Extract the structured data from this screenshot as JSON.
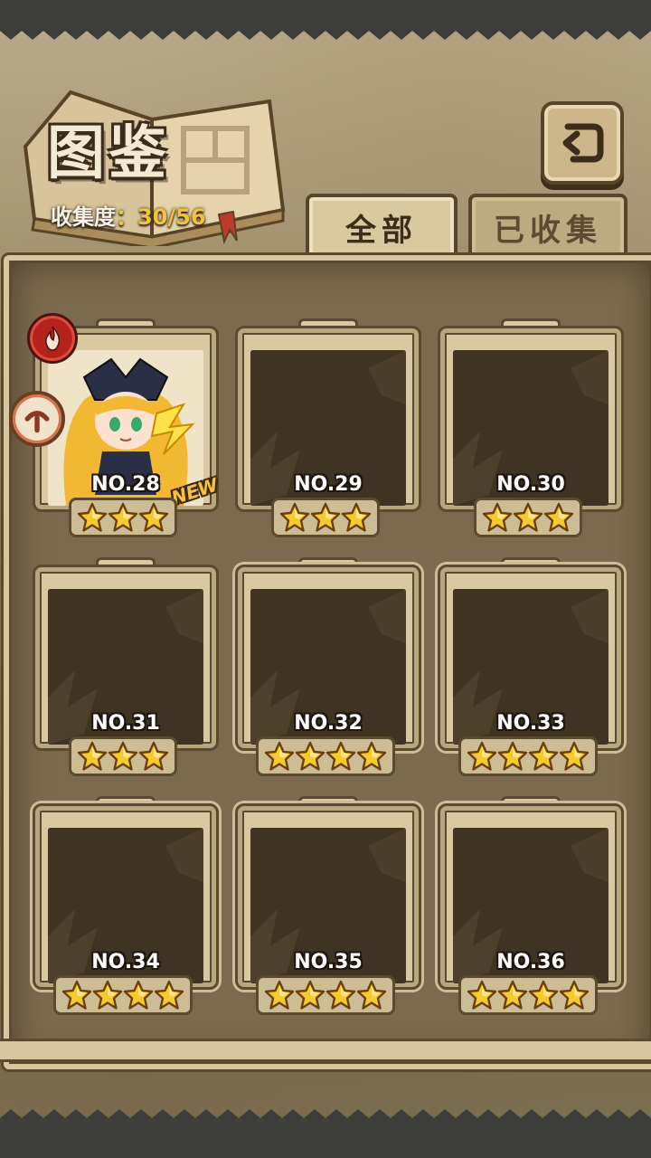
{
  "header": {
    "title": "图鉴",
    "progress_label": "收集度",
    "progress_colon": "：",
    "progress_value": "30/56"
  },
  "tabs": [
    {
      "label": "全部",
      "active": true
    },
    {
      "label": "已收集",
      "active": false
    }
  ],
  "cards": [
    {
      "number": "NO.28",
      "stars": 3,
      "owned": true,
      "new_badge": "NEW"
    },
    {
      "number": "NO.29",
      "stars": 3,
      "owned": false
    },
    {
      "number": "NO.30",
      "stars": 3,
      "owned": false
    },
    {
      "number": "NO.31",
      "stars": 3,
      "owned": false
    },
    {
      "number": "NO.32",
      "stars": 4,
      "owned": false
    },
    {
      "number": "NO.33",
      "stars": 4,
      "owned": false
    },
    {
      "number": "NO.34",
      "stars": 4,
      "owned": false
    },
    {
      "number": "NO.35",
      "stars": 4,
      "owned": false
    },
    {
      "number": "NO.36",
      "stars": 4,
      "owned": false
    }
  ],
  "colors": {
    "accent": "#f4c23a",
    "fire": "#b3231c",
    "slot_dark": "#3f3424",
    "parchment": "#d8c9a1"
  },
  "icons": {
    "back": "back-arrow-icon",
    "element": "fire-element-icon",
    "type": "role-type-icon",
    "star": "star-icon"
  }
}
